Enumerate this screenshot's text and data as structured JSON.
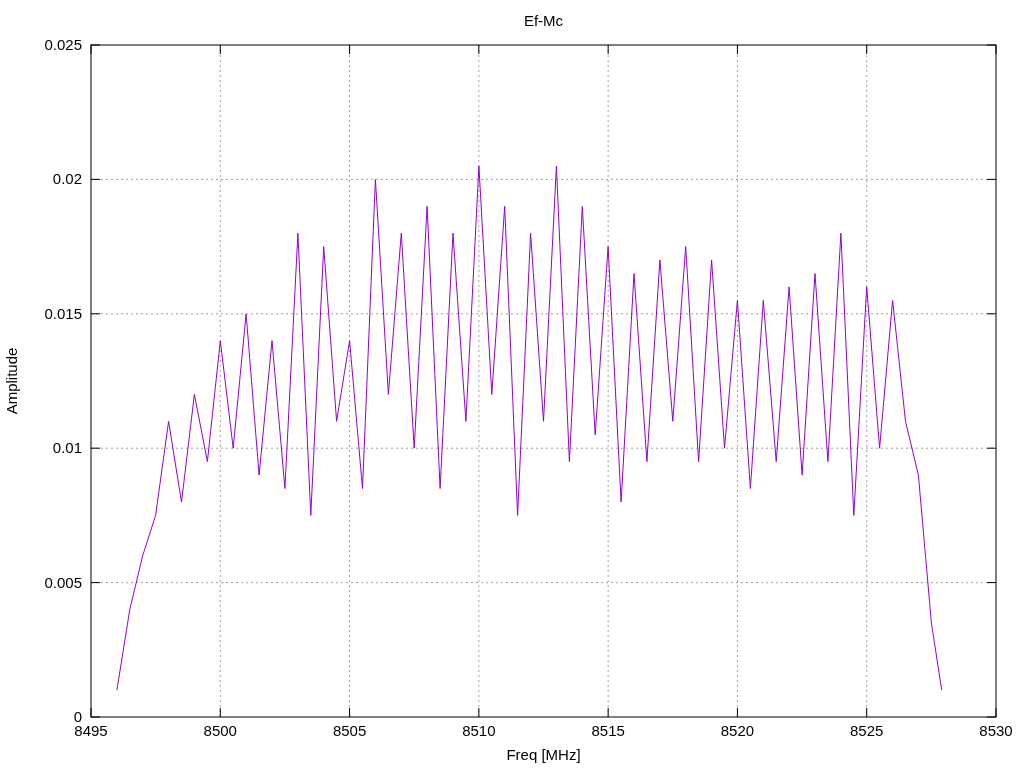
{
  "chart_data": {
    "type": "line",
    "title": "Ef-Mc",
    "xlabel": "Freq [MHz]",
    "ylabel": "Amplitude",
    "x": [
      8496,
      8496.5,
      8497,
      8497.5,
      8498,
      8498.5,
      8499,
      8499.5,
      8500,
      8500.5,
      8501,
      8501.5,
      8502,
      8502.5,
      8503,
      8503.5,
      8504,
      8504.5,
      8505,
      8505.5,
      8506,
      8506.5,
      8507,
      8507.5,
      8508,
      8508.5,
      8509,
      8509.5,
      8510,
      8510.5,
      8511,
      8511.5,
      8512,
      8512.5,
      8513,
      8513.5,
      8514,
      8514.5,
      8515,
      8515.5,
      8516,
      8516.5,
      8517,
      8517.5,
      8518,
      8518.5,
      8519,
      8519.5,
      8520,
      8520.5,
      8521,
      8521.5,
      8522,
      8522.5,
      8523,
      8523.5,
      8524,
      8524.5,
      8525,
      8525.5,
      8526,
      8526.5,
      8527,
      8527.5,
      8527.9
    ],
    "series": [
      {
        "color": "#9400d3",
        "values": [
          0.001,
          0.004,
          0.006,
          0.0075,
          0.011,
          0.008,
          0.012,
          0.0095,
          0.014,
          0.01,
          0.015,
          0.009,
          0.014,
          0.0085,
          0.018,
          0.0075,
          0.0175,
          0.011,
          0.014,
          0.0085,
          0.02,
          0.012,
          0.018,
          0.01,
          0.019,
          0.0085,
          0.018,
          0.011,
          0.0205,
          0.012,
          0.019,
          0.0075,
          0.018,
          0.011,
          0.0205,
          0.0095,
          0.019,
          0.0105,
          0.0175,
          0.008,
          0.0165,
          0.0095,
          0.017,
          0.011,
          0.0175,
          0.0095,
          0.017,
          0.01,
          0.0155,
          0.0085,
          0.0155,
          0.0095,
          0.016,
          0.009,
          0.0165,
          0.0095,
          0.018,
          0.0075,
          0.016,
          0.01,
          0.0155,
          0.011,
          0.009,
          0.0035,
          0.001
        ]
      }
    ],
    "grid": true,
    "xlim": [
      8495,
      8530
    ],
    "ylim": [
      0,
      0.025
    ],
    "xticks": [
      8495,
      8500,
      8505,
      8510,
      8515,
      8520,
      8525,
      8530
    ],
    "yticks": [
      0,
      0.005,
      0.01,
      0.015,
      0.02,
      0.025
    ]
  }
}
